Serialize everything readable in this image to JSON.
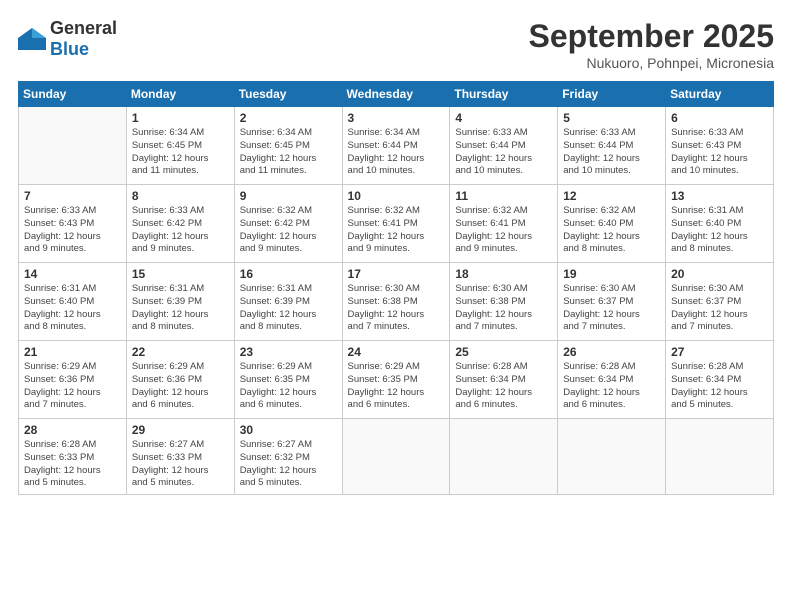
{
  "header": {
    "logo_general": "General",
    "logo_blue": "Blue",
    "title": "September 2025",
    "location": "Nukuoro, Pohnpei, Micronesia"
  },
  "weekdays": [
    "Sunday",
    "Monday",
    "Tuesday",
    "Wednesday",
    "Thursday",
    "Friday",
    "Saturday"
  ],
  "weeks": [
    [
      {
        "day": "",
        "info": ""
      },
      {
        "day": "1",
        "info": "Sunrise: 6:34 AM\nSunset: 6:45 PM\nDaylight: 12 hours\nand 11 minutes."
      },
      {
        "day": "2",
        "info": "Sunrise: 6:34 AM\nSunset: 6:45 PM\nDaylight: 12 hours\nand 11 minutes."
      },
      {
        "day": "3",
        "info": "Sunrise: 6:34 AM\nSunset: 6:44 PM\nDaylight: 12 hours\nand 10 minutes."
      },
      {
        "day": "4",
        "info": "Sunrise: 6:33 AM\nSunset: 6:44 PM\nDaylight: 12 hours\nand 10 minutes."
      },
      {
        "day": "5",
        "info": "Sunrise: 6:33 AM\nSunset: 6:44 PM\nDaylight: 12 hours\nand 10 minutes."
      },
      {
        "day": "6",
        "info": "Sunrise: 6:33 AM\nSunset: 6:43 PM\nDaylight: 12 hours\nand 10 minutes."
      }
    ],
    [
      {
        "day": "7",
        "info": "Sunrise: 6:33 AM\nSunset: 6:43 PM\nDaylight: 12 hours\nand 9 minutes."
      },
      {
        "day": "8",
        "info": "Sunrise: 6:33 AM\nSunset: 6:42 PM\nDaylight: 12 hours\nand 9 minutes."
      },
      {
        "day": "9",
        "info": "Sunrise: 6:32 AM\nSunset: 6:42 PM\nDaylight: 12 hours\nand 9 minutes."
      },
      {
        "day": "10",
        "info": "Sunrise: 6:32 AM\nSunset: 6:41 PM\nDaylight: 12 hours\nand 9 minutes."
      },
      {
        "day": "11",
        "info": "Sunrise: 6:32 AM\nSunset: 6:41 PM\nDaylight: 12 hours\nand 9 minutes."
      },
      {
        "day": "12",
        "info": "Sunrise: 6:32 AM\nSunset: 6:40 PM\nDaylight: 12 hours\nand 8 minutes."
      },
      {
        "day": "13",
        "info": "Sunrise: 6:31 AM\nSunset: 6:40 PM\nDaylight: 12 hours\nand 8 minutes."
      }
    ],
    [
      {
        "day": "14",
        "info": "Sunrise: 6:31 AM\nSunset: 6:40 PM\nDaylight: 12 hours\nand 8 minutes."
      },
      {
        "day": "15",
        "info": "Sunrise: 6:31 AM\nSunset: 6:39 PM\nDaylight: 12 hours\nand 8 minutes."
      },
      {
        "day": "16",
        "info": "Sunrise: 6:31 AM\nSunset: 6:39 PM\nDaylight: 12 hours\nand 8 minutes."
      },
      {
        "day": "17",
        "info": "Sunrise: 6:30 AM\nSunset: 6:38 PM\nDaylight: 12 hours\nand 7 minutes."
      },
      {
        "day": "18",
        "info": "Sunrise: 6:30 AM\nSunset: 6:38 PM\nDaylight: 12 hours\nand 7 minutes."
      },
      {
        "day": "19",
        "info": "Sunrise: 6:30 AM\nSunset: 6:37 PM\nDaylight: 12 hours\nand 7 minutes."
      },
      {
        "day": "20",
        "info": "Sunrise: 6:30 AM\nSunset: 6:37 PM\nDaylight: 12 hours\nand 7 minutes."
      }
    ],
    [
      {
        "day": "21",
        "info": "Sunrise: 6:29 AM\nSunset: 6:36 PM\nDaylight: 12 hours\nand 7 minutes."
      },
      {
        "day": "22",
        "info": "Sunrise: 6:29 AM\nSunset: 6:36 PM\nDaylight: 12 hours\nand 6 minutes."
      },
      {
        "day": "23",
        "info": "Sunrise: 6:29 AM\nSunset: 6:35 PM\nDaylight: 12 hours\nand 6 minutes."
      },
      {
        "day": "24",
        "info": "Sunrise: 6:29 AM\nSunset: 6:35 PM\nDaylight: 12 hours\nand 6 minutes."
      },
      {
        "day": "25",
        "info": "Sunrise: 6:28 AM\nSunset: 6:34 PM\nDaylight: 12 hours\nand 6 minutes."
      },
      {
        "day": "26",
        "info": "Sunrise: 6:28 AM\nSunset: 6:34 PM\nDaylight: 12 hours\nand 6 minutes."
      },
      {
        "day": "27",
        "info": "Sunrise: 6:28 AM\nSunset: 6:34 PM\nDaylight: 12 hours\nand 5 minutes."
      }
    ],
    [
      {
        "day": "28",
        "info": "Sunrise: 6:28 AM\nSunset: 6:33 PM\nDaylight: 12 hours\nand 5 minutes."
      },
      {
        "day": "29",
        "info": "Sunrise: 6:27 AM\nSunset: 6:33 PM\nDaylight: 12 hours\nand 5 minutes."
      },
      {
        "day": "30",
        "info": "Sunrise: 6:27 AM\nSunset: 6:32 PM\nDaylight: 12 hours\nand 5 minutes."
      },
      {
        "day": "",
        "info": ""
      },
      {
        "day": "",
        "info": ""
      },
      {
        "day": "",
        "info": ""
      },
      {
        "day": "",
        "info": ""
      }
    ]
  ]
}
